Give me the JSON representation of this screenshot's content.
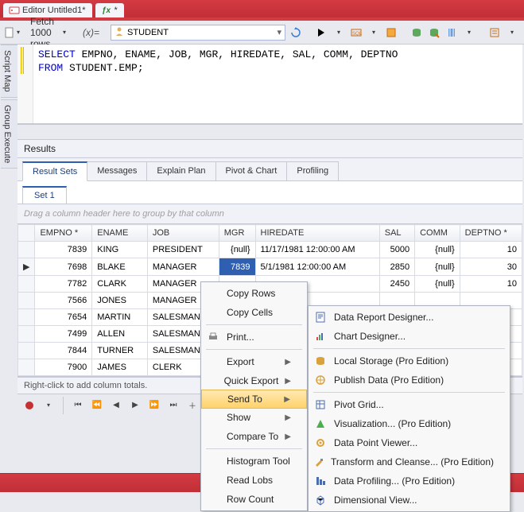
{
  "top_tabs": [
    {
      "label": "Editor Untitled1*",
      "icon": "sql"
    },
    {
      "label": "*",
      "icon": "fx"
    }
  ],
  "toolbar": {
    "fetch_label": "Fetch 1000 rows",
    "fx_label": "(x)=",
    "schema_value": "STUDENT"
  },
  "side_tabs": [
    "Script Map",
    "Group Execute"
  ],
  "sql": {
    "line1_pre": "SELECT",
    "line1_rest": " EMPNO, ENAME, JOB, MGR, HIREDATE, SAL, COMM, DEPTNO",
    "line2_pre": "FROM",
    "line2_rest": " STUDENT.EMP;"
  },
  "results_title": "Results",
  "result_tabs": [
    "Result Sets",
    "Messages",
    "Explain Plan",
    "Pivot & Chart",
    "Profiling"
  ],
  "set_tab": "Set 1",
  "group_hint": "Drag a column header here to group by that column",
  "columns": [
    "EMPNO *",
    "ENAME",
    "JOB",
    "MGR",
    "HIREDATE",
    "SAL",
    "COMM",
    "DEPTNO *"
  ],
  "rows": [
    {
      "empno": "7839",
      "ename": "KING",
      "job": "PRESIDENT",
      "mgr": "{null}",
      "hiredate": "11/17/1981 12:00:00 AM",
      "sal": "5000",
      "comm": "{null}",
      "deptno": "10",
      "sel": false,
      "cur": false
    },
    {
      "empno": "7698",
      "ename": "BLAKE",
      "job": "MANAGER",
      "mgr": "7839",
      "hiredate": "5/1/1981 12:00:00 AM",
      "sal": "2850",
      "comm": "{null}",
      "deptno": "30",
      "sel": true,
      "cur": true
    },
    {
      "empno": "7782",
      "ename": "CLARK",
      "job": "MANAGER",
      "mgr": "",
      "hiredate": "",
      "sal": "2450",
      "comm": "{null}",
      "deptno": "10",
      "sel": false,
      "cur": false
    },
    {
      "empno": "7566",
      "ename": "JONES",
      "job": "MANAGER",
      "mgr": "",
      "hiredate": "",
      "sal": "",
      "comm": "",
      "deptno": "",
      "sel": false,
      "cur": false
    },
    {
      "empno": "7654",
      "ename": "MARTIN",
      "job": "SALESMAN",
      "mgr": "",
      "hiredate": "",
      "sal": "",
      "comm": "",
      "deptno": "",
      "sel": false,
      "cur": false
    },
    {
      "empno": "7499",
      "ename": "ALLEN",
      "job": "SALESMAN",
      "mgr": "",
      "hiredate": "",
      "sal": "",
      "comm": "",
      "deptno": "",
      "sel": false,
      "cur": false
    },
    {
      "empno": "7844",
      "ename": "TURNER",
      "job": "SALESMAN",
      "mgr": "",
      "hiredate": "",
      "sal": "",
      "comm": "",
      "deptno": "",
      "sel": false,
      "cur": false
    },
    {
      "empno": "7900",
      "ename": "JAMES",
      "job": "CLERK",
      "mgr": "",
      "hiredate": "",
      "sal": "",
      "comm": "",
      "deptno": "",
      "sel": false,
      "cur": false
    }
  ],
  "totals_hint": "Right-click to add column totals.",
  "menu1": {
    "copy_rows": "Copy Rows",
    "copy_cells": "Copy Cells",
    "print": "Print...",
    "export": "Export",
    "quick_export": "Quick Export",
    "send_to": "Send To",
    "show": "Show",
    "compare_to": "Compare To",
    "histogram": "Histogram Tool",
    "read_lobs": "Read Lobs",
    "row_count": "Row Count"
  },
  "menu2": {
    "data_report": "Data Report Designer...",
    "chart_designer": "Chart Designer...",
    "local_storage": "Local Storage (Pro Edition)",
    "publish": "Publish Data (Pro Edition)",
    "pivot": "Pivot Grid...",
    "visualization": "Visualization... (Pro Edition)",
    "data_point": " Data Point Viewer...",
    "transform": "Transform and Cleanse... (Pro Edition)",
    "profiling": "Data Profiling... (Pro Edition)",
    "dimensional": "Dimensional View..."
  }
}
